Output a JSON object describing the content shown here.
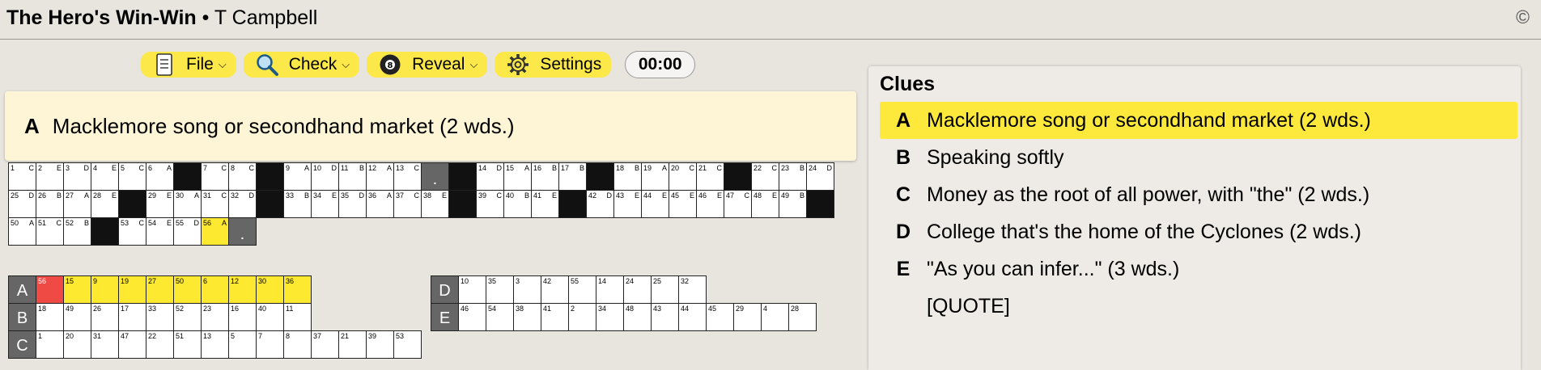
{
  "header": {
    "title": "The Hero's Win-Win",
    "separator": "•",
    "author": "T Campbell",
    "copyright": "©"
  },
  "toolbar": {
    "file_label": "File",
    "check_label": "Check",
    "reveal_label": "Reveal",
    "settings_label": "Settings",
    "timer": "00:00",
    "icons": [
      "document-icon",
      "magnifier-icon",
      "eight-ball-icon",
      "gear-icon"
    ]
  },
  "current_clue": {
    "letter": "A",
    "text": "Macklemore song or secondhand market (2 wds.)"
  },
  "quote_grid": {
    "rows": [
      [
        {
          "n": "1",
          "l": "C"
        },
        {
          "n": "2",
          "l": "E"
        },
        {
          "n": "3",
          "l": "D"
        },
        {
          "n": "4",
          "l": "E"
        },
        {
          "n": "5",
          "l": "C"
        },
        {
          "n": "6",
          "l": "A"
        },
        {
          "b": true
        },
        {
          "n": "7",
          "l": "C"
        },
        {
          "n": "8",
          "l": "C"
        },
        {
          "b": true
        },
        {
          "n": "9",
          "l": "A"
        },
        {
          "n": "10",
          "l": "D"
        },
        {
          "n": "11",
          "l": "B"
        },
        {
          "n": "12",
          "l": "A"
        },
        {
          "n": "13",
          "l": "C"
        },
        {
          "p": "."
        },
        {
          "b": true
        },
        {
          "n": "14",
          "l": "D"
        },
        {
          "n": "15",
          "l": "A"
        },
        {
          "n": "16",
          "l": "B"
        },
        {
          "n": "17",
          "l": "B"
        },
        {
          "b": true
        },
        {
          "n": "18",
          "l": "B"
        },
        {
          "n": "19",
          "l": "A"
        },
        {
          "n": "20",
          "l": "C"
        },
        {
          "n": "21",
          "l": "C"
        },
        {
          "b": true
        },
        {
          "n": "22",
          "l": "C"
        },
        {
          "n": "23",
          "l": "B"
        },
        {
          "n": "24",
          "l": "D"
        }
      ],
      [
        {
          "n": "25",
          "l": "D"
        },
        {
          "n": "26",
          "l": "B"
        },
        {
          "n": "27",
          "l": "A"
        },
        {
          "n": "28",
          "l": "E"
        },
        {
          "b": true
        },
        {
          "n": "29",
          "l": "E"
        },
        {
          "n": "30",
          "l": "A"
        },
        {
          "n": "31",
          "l": "C"
        },
        {
          "n": "32",
          "l": "D"
        },
        {
          "b": true
        },
        {
          "n": "33",
          "l": "B"
        },
        {
          "n": "34",
          "l": "E"
        },
        {
          "n": "35",
          "l": "D"
        },
        {
          "n": "36",
          "l": "A"
        },
        {
          "n": "37",
          "l": "C"
        },
        {
          "n": "38",
          "l": "E"
        },
        {
          "b": true
        },
        {
          "n": "39",
          "l": "C"
        },
        {
          "n": "40",
          "l": "B"
        },
        {
          "n": "41",
          "l": "E"
        },
        {
          "b": true
        },
        {
          "n": "42",
          "l": "D"
        },
        {
          "n": "43",
          "l": "E"
        },
        {
          "n": "44",
          "l": "E"
        },
        {
          "n": "45",
          "l": "E"
        },
        {
          "n": "46",
          "l": "E"
        },
        {
          "n": "47",
          "l": "C"
        },
        {
          "n": "48",
          "l": "E"
        },
        {
          "n": "49",
          "l": "B"
        },
        {
          "b": true
        }
      ],
      [
        {
          "n": "50",
          "l": "A"
        },
        {
          "n": "51",
          "l": "C"
        },
        {
          "n": "52",
          "l": "B"
        },
        {
          "b": true
        },
        {
          "n": "53",
          "l": "C"
        },
        {
          "n": "54",
          "l": "E"
        },
        {
          "n": "55",
          "l": "D"
        },
        {
          "n": "56",
          "l": "A",
          "h": true
        },
        {
          "p": "."
        }
      ]
    ]
  },
  "answer_grid": {
    "left": [
      {
        "letter": "A",
        "cells": [
          {
            "n": "56",
            "c": true
          },
          {
            "n": "15",
            "h": true
          },
          {
            "n": "9",
            "h": true
          },
          {
            "n": "19",
            "h": true
          },
          {
            "n": "27",
            "h": true
          },
          {
            "n": "50",
            "h": true
          },
          {
            "n": "6",
            "h": true
          },
          {
            "n": "12",
            "h": true
          },
          {
            "n": "30",
            "h": true
          },
          {
            "n": "36",
            "h": true
          }
        ]
      },
      {
        "letter": "B",
        "cells": [
          {
            "n": "18"
          },
          {
            "n": "49"
          },
          {
            "n": "26"
          },
          {
            "n": "17"
          },
          {
            "n": "33"
          },
          {
            "n": "52"
          },
          {
            "n": "23"
          },
          {
            "n": "16"
          },
          {
            "n": "40"
          },
          {
            "n": "11"
          }
        ]
      },
      {
        "letter": "C",
        "cells": [
          {
            "n": "1"
          },
          {
            "n": "20"
          },
          {
            "n": "31"
          },
          {
            "n": "47"
          },
          {
            "n": "22"
          },
          {
            "n": "51"
          },
          {
            "n": "13"
          },
          {
            "n": "5"
          },
          {
            "n": "7"
          },
          {
            "n": "8"
          },
          {
            "n": "37"
          },
          {
            "n": "21"
          },
          {
            "n": "39"
          },
          {
            "n": "53"
          }
        ]
      }
    ],
    "right": [
      {
        "letter": "D",
        "cells": [
          {
            "n": "10"
          },
          {
            "n": "35"
          },
          {
            "n": "3"
          },
          {
            "n": "42"
          },
          {
            "n": "55"
          },
          {
            "n": "14"
          },
          {
            "n": "24"
          },
          {
            "n": "25"
          },
          {
            "n": "32"
          }
        ]
      },
      {
        "letter": "E",
        "cells": [
          {
            "n": "46"
          },
          {
            "n": "54"
          },
          {
            "n": "38"
          },
          {
            "n": "41"
          },
          {
            "n": "2"
          },
          {
            "n": "34"
          },
          {
            "n": "48"
          },
          {
            "n": "43"
          },
          {
            "n": "44"
          },
          {
            "n": "45"
          },
          {
            "n": "29"
          },
          {
            "n": "4"
          },
          {
            "n": "28"
          }
        ]
      }
    ]
  },
  "clues_panel": {
    "title": "Clues",
    "items": [
      {
        "letter": "A",
        "text": "Macklemore song or secondhand market (2 wds.)",
        "active": true
      },
      {
        "letter": "B",
        "text": "Speaking softly"
      },
      {
        "letter": "C",
        "text": "Money as the root of all power, with \"the\" (2 wds.)"
      },
      {
        "letter": "D",
        "text": "College that's the home of the Cyclones (2 wds.)"
      },
      {
        "letter": "E",
        "text": "\"As you can infer...\" (3 wds.)"
      },
      {
        "letter": "",
        "text": "[QUOTE]"
      }
    ]
  },
  "colors": {
    "highlight": "#fde92f",
    "current_cell": "#f04a45",
    "clue_bar": "#fdf5d6",
    "background": "#e8e4de"
  }
}
